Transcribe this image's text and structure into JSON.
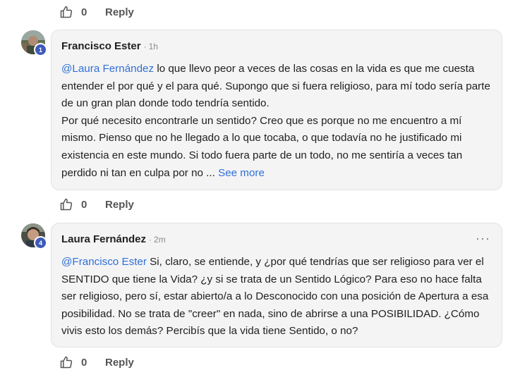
{
  "colors": {
    "link": "#2f6fd6",
    "card_bg": "#f4f4f5",
    "badge_bg": "#3e5ab8"
  },
  "top_actions": {
    "like_count": "0",
    "reply_label": "Reply"
  },
  "comments": [
    {
      "author": "Francisco Ester",
      "dot": "·",
      "time": "1h",
      "avatar_badge": "1",
      "mention": "@Laura Fernández",
      "text_line1": " lo que llevo peor a veces de las cosas en la vida es que me cuesta entender el por qué y el para qué. Supongo que si fuera religioso, para mí todo sería parte de un gran plan donde todo tendría sentido.",
      "text_line2": "Por qué necesito encontrarle un sentido? Creo que es porque no me encuentro a mí mismo. Pienso que no he llegado a lo que tocaba, o que todavía no he justificado mi existencia en este mundo. Si todo fuera parte de un todo, no me sentiría a veces tan perdido ni tan en culpa por no ... ",
      "see_more": "See more",
      "like_count": "0",
      "reply_label": "Reply"
    },
    {
      "author": "Laura Fernández",
      "dot": "·",
      "time": "2m",
      "avatar_badge": "4",
      "more_menu": "···",
      "mention": "@Francisco Ester",
      "text": " Si, claro, se entiende, y ¿por qué tendrías que ser religioso para ver el SENTIDO que tiene la Vida? ¿y si se trata de un Sentido Lógico? Para eso no hace falta ser religioso, pero sí, estar abierto/a a lo Desconocido con una posición de Apertura a esa posibilidad. No se trata de \"creer\" en nada, sino de abrirse a una POSIBILIDAD. ¿Cómo vivis esto los demás? Percibís que la vida tiene Sentido, o no?",
      "like_count": "0",
      "reply_label": "Reply"
    }
  ]
}
